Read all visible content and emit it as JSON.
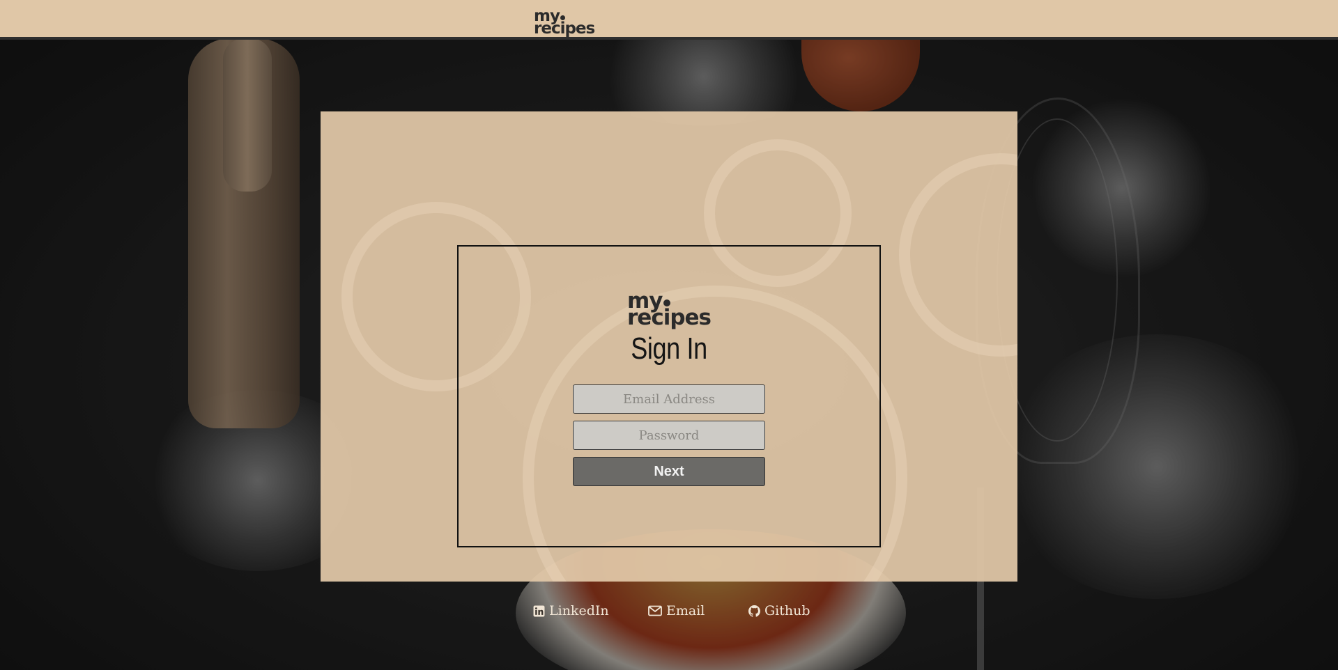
{
  "header": {
    "logo_line1": "my",
    "logo_line2": "recipes"
  },
  "signin": {
    "logo_line1": "my",
    "logo_line2": "recipes",
    "title": "Sign In",
    "email_placeholder": "Email Address",
    "email_value": "",
    "password_placeholder": "Password",
    "password_value": "",
    "next_label": "Next"
  },
  "footer": {
    "links": [
      {
        "label": "LinkedIn",
        "icon": "linkedin-icon"
      },
      {
        "label": "Email",
        "icon": "envelope-icon"
      },
      {
        "label": "Github",
        "icon": "github-icon"
      }
    ]
  },
  "colors": {
    "header_bg": "#e0c7a7",
    "panel_bg": "#e0c7a7",
    "button_bg": "#6b6a67",
    "input_bg": "#cdcbc6",
    "footer_text": "#f1e6d6"
  }
}
